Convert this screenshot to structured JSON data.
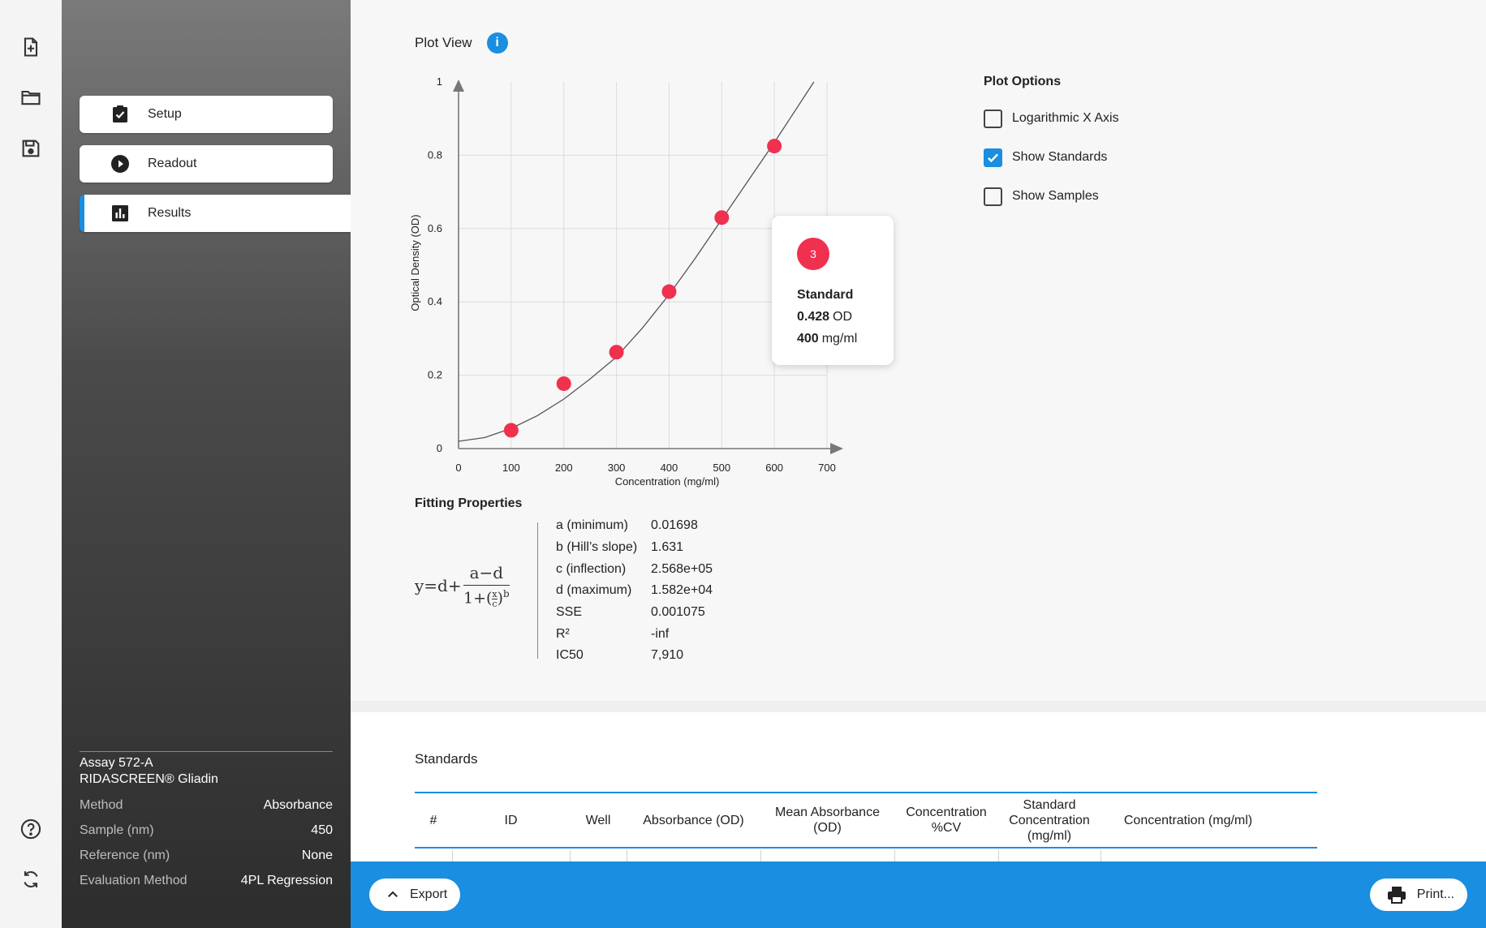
{
  "rail": {
    "icons": [
      "file-add-icon",
      "folder-icon",
      "save-icon",
      "help-icon",
      "refresh-icon"
    ]
  },
  "nav": {
    "items": [
      {
        "label": "Setup",
        "icon": "clipboard-check-icon"
      },
      {
        "label": "Readout",
        "icon": "play-circle-icon"
      },
      {
        "label": "Results",
        "icon": "bar-chart-icon",
        "active": true
      }
    ]
  },
  "assay": {
    "name": "Assay 572-A",
    "kit": "RIDASCREEN® Gliadin",
    "rows": [
      {
        "key": "Method",
        "value": "Absorbance"
      },
      {
        "key": "Sample (nm)",
        "value": "450"
      },
      {
        "key": "Reference (nm)",
        "value": "None"
      },
      {
        "key": "Evaluation Method",
        "value": "4PL Regression"
      }
    ]
  },
  "plot": {
    "title": "Plot View",
    "info_glyph": "i"
  },
  "tooltip": {
    "badge": "3",
    "kind": "Standard",
    "od_value": "0.428",
    "od_unit": "OD",
    "conc_value": "400",
    "conc_unit": "mg/ml"
  },
  "plot_options": {
    "title": "Plot Options",
    "options": [
      {
        "label": "Logarithmic X Axis",
        "checked": false
      },
      {
        "label": "Show Standards",
        "checked": true
      },
      {
        "label": "Show Samples",
        "checked": false
      }
    ]
  },
  "chart_data": {
    "type": "scatter",
    "title": "",
    "xlabel": "Concentration (mg/ml)",
    "ylabel": "Optical Density (OD)",
    "xlim": [
      0,
      700
    ],
    "ylim": [
      0,
      1
    ],
    "x_ticks": [
      "0",
      "100",
      "200",
      "300",
      "400",
      "500",
      "600",
      "700"
    ],
    "y_ticks": [
      "0",
      "0.2",
      "0.4",
      "0.6",
      "0.8",
      "1"
    ],
    "grid": true,
    "series": [
      {
        "x": [
          100,
          200,
          300,
          400,
          500,
          600
        ],
        "y": [
          0.05,
          0.177,
          0.263,
          0.428,
          0.63,
          0.825
        ]
      }
    ],
    "fit_curve": {
      "x": [
        0,
        50,
        100,
        150,
        200,
        250,
        300,
        350,
        400,
        450,
        500,
        550,
        600,
        650,
        675
      ],
      "y": [
        0.02,
        0.03,
        0.055,
        0.09,
        0.135,
        0.19,
        0.25,
        0.33,
        0.42,
        0.52,
        0.625,
        0.73,
        0.835,
        0.945,
        1.0
      ]
    }
  },
  "fitting": {
    "title": "Fitting Properties",
    "formula": {
      "lhs": "y=d+",
      "numerator": "a−d",
      "denominator_base": "1+(",
      "x": "x",
      "c": "c",
      "close": ")",
      "exponent": "b"
    },
    "rows": [
      {
        "key": "a (minimum)",
        "value": "0.01698"
      },
      {
        "key": "b (Hill’s slope)",
        "value": "1.631"
      },
      {
        "key": "c (inflection)",
        "value": "2.568e+05"
      },
      {
        "key": "d (maximum)",
        "value": "1.582e+04"
      },
      {
        "key": "SSE",
        "value": "0.001075"
      },
      {
        "key": "R²",
        "value": "-inf"
      },
      {
        "key": "IC50",
        "value": "7,910"
      }
    ]
  },
  "standards": {
    "title": "Standards",
    "columns": [
      "#",
      "ID",
      "Well",
      "Absorbance (OD)",
      "Mean Absorbance (OD)",
      "Concentration %CV",
      "Standard Concentration (mg/ml)",
      "Concentration (mg/ml)"
    ]
  },
  "footer": {
    "export_label": "Export",
    "print_label": "Print..."
  },
  "colors": {
    "accent": "#1a8ee0",
    "point": "#f0304f"
  }
}
